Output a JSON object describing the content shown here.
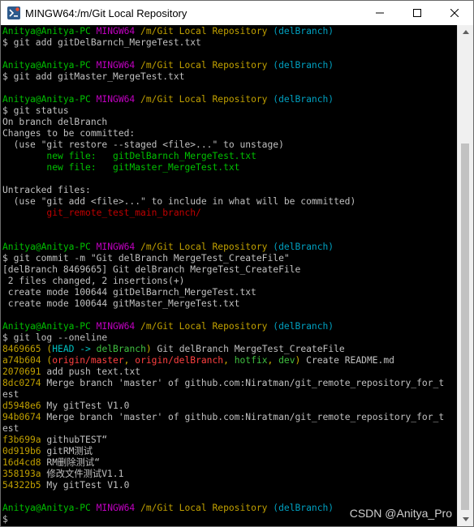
{
  "window": {
    "title": "MINGW64:/m/Git Local Repository",
    "buttons": {
      "minimize": "minimize-icon",
      "maximize": "maximize-icon",
      "close": "close-icon"
    }
  },
  "colors": {
    "terminal_bg": "#000000",
    "default_text": "#c0c0c0",
    "user_green": "#00c000",
    "mingw_magenta": "#c000c0",
    "path_yellow": "#c0a000",
    "branch_cyan": "#00a0c0",
    "staged_green": "#00c000",
    "untracked_red": "#c00000"
  },
  "terminal": {
    "lines": [
      [
        {
          "t": "Anitya@Anitya-PC ",
          "c": "c-green"
        },
        {
          "t": "MINGW64 ",
          "c": "c-magenta"
        },
        {
          "t": "/m/Git Local Repository ",
          "c": "c-yellow"
        },
        {
          "t": "(delBranch)",
          "c": "c-cyan"
        }
      ],
      [
        {
          "t": "$ git add gitDelBarnch_MergeTest.txt"
        }
      ],
      [
        {
          "t": ""
        }
      ],
      [
        {
          "t": "Anitya@Anitya-PC ",
          "c": "c-green"
        },
        {
          "t": "MINGW64 ",
          "c": "c-magenta"
        },
        {
          "t": "/m/Git Local Repository ",
          "c": "c-yellow"
        },
        {
          "t": "(delBranch)",
          "c": "c-cyan"
        }
      ],
      [
        {
          "t": "$ git add gitMaster_MergeTest.txt"
        }
      ],
      [
        {
          "t": ""
        }
      ],
      [
        {
          "t": "Anitya@Anitya-PC ",
          "c": "c-green"
        },
        {
          "t": "MINGW64 ",
          "c": "c-magenta"
        },
        {
          "t": "/m/Git Local Repository ",
          "c": "c-yellow"
        },
        {
          "t": "(delBranch)",
          "c": "c-cyan"
        }
      ],
      [
        {
          "t": "$ git status"
        }
      ],
      [
        {
          "t": "On branch delBranch"
        }
      ],
      [
        {
          "t": "Changes to be committed:"
        }
      ],
      [
        {
          "t": "  (use \"git restore --staged <file>...\" to unstage)"
        }
      ],
      [
        {
          "t": "        "
        },
        {
          "t": "new file:   gitDelBarnch_MergeTest.txt",
          "c": "c-green"
        }
      ],
      [
        {
          "t": "        "
        },
        {
          "t": "new file:   gitMaster_MergeTest.txt",
          "c": "c-green"
        }
      ],
      [
        {
          "t": ""
        }
      ],
      [
        {
          "t": "Untracked files:"
        }
      ],
      [
        {
          "t": "  (use \"git add <file>...\" to include in what will be committed)"
        }
      ],
      [
        {
          "t": "        "
        },
        {
          "t": "git_remote_test_main_branch/",
          "c": "c-red"
        }
      ],
      [
        {
          "t": ""
        }
      ],
      [
        {
          "t": ""
        }
      ],
      [
        {
          "t": "Anitya@Anitya-PC ",
          "c": "c-green"
        },
        {
          "t": "MINGW64 ",
          "c": "c-magenta"
        },
        {
          "t": "/m/Git Local Repository ",
          "c": "c-yellow"
        },
        {
          "t": "(delBranch)",
          "c": "c-cyan"
        }
      ],
      [
        {
          "t": "$ git commit -m \"Git delBranch MergeTest_CreateFile\""
        }
      ],
      [
        {
          "t": "[delBranch 8469665] Git delBranch MergeTest_CreateFile"
        }
      ],
      [
        {
          "t": " 2 files changed, 2 insertions(+)"
        }
      ],
      [
        {
          "t": " create mode 100644 gitDelBarnch_MergeTest.txt"
        }
      ],
      [
        {
          "t": " create mode 100644 gitMaster_MergeTest.txt"
        }
      ],
      [
        {
          "t": ""
        }
      ],
      [
        {
          "t": "Anitya@Anitya-PC ",
          "c": "c-green"
        },
        {
          "t": "MINGW64 ",
          "c": "c-magenta"
        },
        {
          "t": "/m/Git Local Repository ",
          "c": "c-yellow"
        },
        {
          "t": "(delBranch)",
          "c": "c-cyan"
        }
      ],
      [
        {
          "t": "$ git log --oneline"
        }
      ],
      [
        {
          "t": "8469665 ",
          "c": "c-yellow"
        },
        {
          "t": "(",
          "c": "c-byellow"
        },
        {
          "t": "HEAD -> ",
          "c": "c-bcyan"
        },
        {
          "t": "delBranch",
          "c": "c-bgreen"
        },
        {
          "t": ")",
          "c": "c-byellow"
        },
        {
          "t": " Git delBranch MergeTest_CreateFile"
        }
      ],
      [
        {
          "t": "a74b604 ",
          "c": "c-yellow"
        },
        {
          "t": "(",
          "c": "c-byellow"
        },
        {
          "t": "origin/master",
          "c": "c-bred"
        },
        {
          "t": ", ",
          "c": "c-byellow"
        },
        {
          "t": "origin/delBranch",
          "c": "c-bred"
        },
        {
          "t": ", ",
          "c": "c-byellow"
        },
        {
          "t": "hotfix",
          "c": "c-bgreen"
        },
        {
          "t": ", ",
          "c": "c-byellow"
        },
        {
          "t": "dev",
          "c": "c-bgreen"
        },
        {
          "t": ")",
          "c": "c-byellow"
        },
        {
          "t": " Create README.md"
        }
      ],
      [
        {
          "t": "2070691 ",
          "c": "c-yellow"
        },
        {
          "t": "add push text.txt"
        }
      ],
      [
        {
          "t": "8dc0274 ",
          "c": "c-yellow"
        },
        {
          "t": "Merge branch 'master' of github.com:Niratman/git_remote_repository_for_t"
        }
      ],
      [
        {
          "t": "est"
        }
      ],
      [
        {
          "t": "d5948e6 ",
          "c": "c-yellow"
        },
        {
          "t": "My gitTest V1.0"
        }
      ],
      [
        {
          "t": "94b0674 ",
          "c": "c-yellow"
        },
        {
          "t": "Merge branch 'master' of github.com:Niratman/git_remote_repository_for_t"
        }
      ],
      [
        {
          "t": "est"
        }
      ],
      [
        {
          "t": "f3b699a ",
          "c": "c-yellow"
        },
        {
          "t": "githubTEST“"
        }
      ],
      [
        {
          "t": "0d919b6 ",
          "c": "c-yellow"
        },
        {
          "t": "gitRM测试"
        }
      ],
      [
        {
          "t": "16d4cd8 ",
          "c": "c-yellow"
        },
        {
          "t": "RM删除测试“"
        }
      ],
      [
        {
          "t": "358193a ",
          "c": "c-yellow"
        },
        {
          "t": "修改文件测试V1.1"
        }
      ],
      [
        {
          "t": "54322b5 ",
          "c": "c-yellow"
        },
        {
          "t": "My gitTest V1.0"
        }
      ],
      [
        {
          "t": ""
        }
      ],
      [
        {
          "t": "Anitya@Anitya-PC ",
          "c": "c-green"
        },
        {
          "t": "MINGW64 ",
          "c": "c-magenta"
        },
        {
          "t": "/m/Git Local Repository ",
          "c": "c-yellow"
        },
        {
          "t": "(delBranch)",
          "c": "c-cyan"
        }
      ],
      [
        {
          "t": "$ "
        }
      ]
    ]
  },
  "watermark": "CSDN @Anitya_Pro"
}
